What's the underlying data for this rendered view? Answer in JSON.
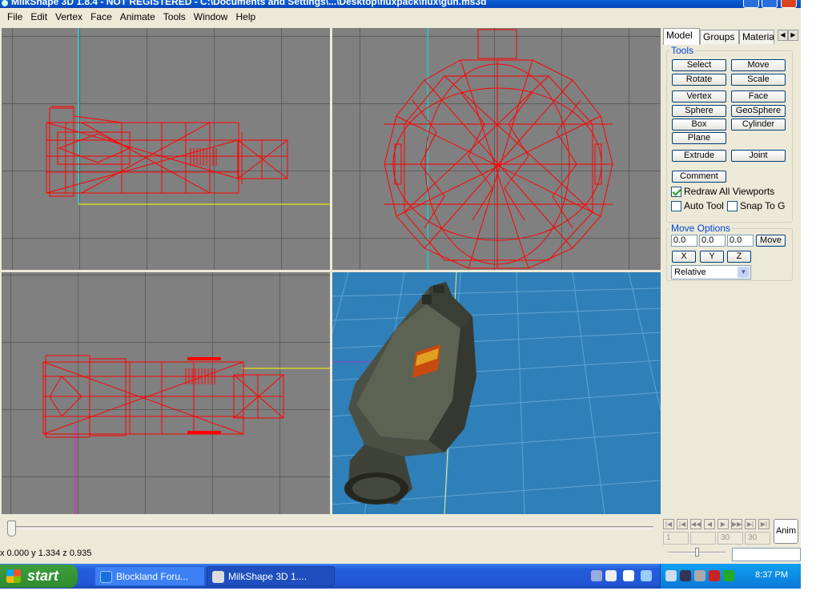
{
  "window": {
    "title": "MilkShape 3D 1.8.4 - NOT REGISTERED - C:\\Documents and Settings\\...\\Desktop\\fluxpack\\flux\\gun.ms3d"
  },
  "menu": [
    "File",
    "Edit",
    "Vertex",
    "Face",
    "Animate",
    "Tools",
    "Window",
    "Help"
  ],
  "tabs": [
    "Model",
    "Groups",
    "Materia"
  ],
  "tools": {
    "group_label": "Tools",
    "buttons": [
      "Select",
      "Move",
      "Rotate",
      "Scale",
      "Vertex",
      "Face",
      "Sphere",
      "GeoSphere",
      "Box",
      "Cylinder",
      "Plane",
      "Extrude",
      "Joint"
    ],
    "comment": "Comment",
    "redraw": "Redraw All Viewports",
    "auto_tool": "Auto Tool",
    "snap_to": "Snap To G"
  },
  "move_options": {
    "group_label": "Move Options",
    "x": "0.0",
    "y": "0.0",
    "z": "0.0",
    "move_btn": "Move",
    "axis": [
      "X",
      "Y",
      "Z"
    ],
    "mode": "Relative"
  },
  "timeline": {
    "frame_start": "1",
    "frame_end": "30",
    "frame_total": "30",
    "anim": "Anim"
  },
  "status": {
    "coords": "x 0.000 y 1.334 z 0.935"
  },
  "taskbar": {
    "start": "start",
    "tasks": [
      "Blockland Foru...",
      "MilkShape 3D 1...."
    ],
    "time": "8:37 PM"
  },
  "colors": {
    "wire": "#ff0000",
    "viewport_bg": "#808080",
    "perspective_bg": "#2f7fb8",
    "taskbar": "#245edb"
  }
}
